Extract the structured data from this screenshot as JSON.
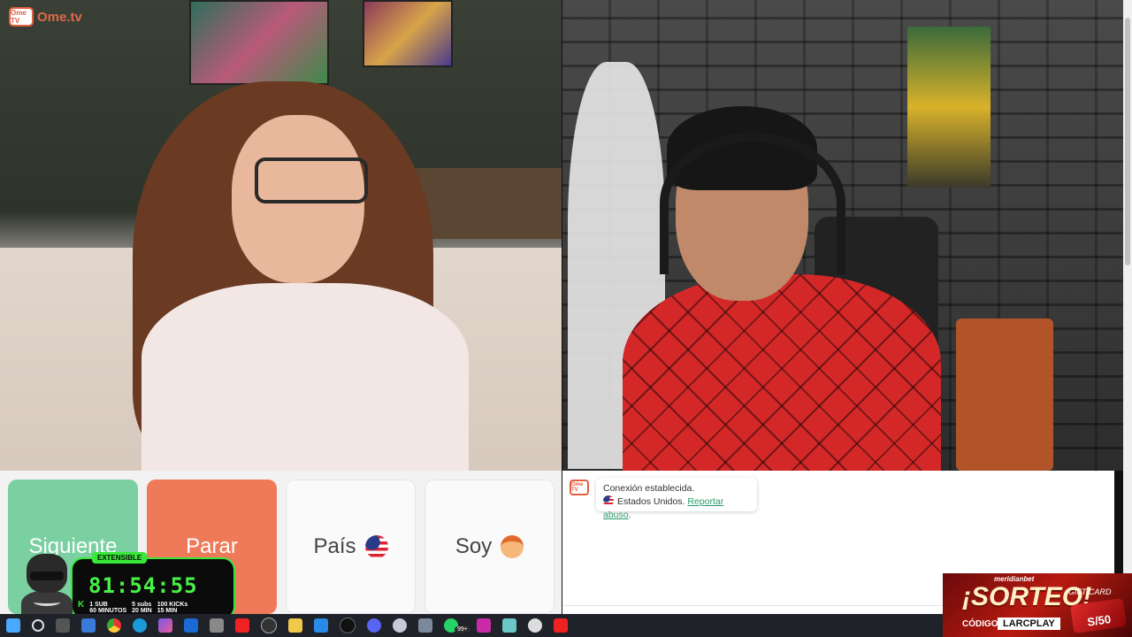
{
  "app": {
    "logo_text": "Ome.tv",
    "logo_tv": "Ome TV"
  },
  "controls": {
    "next_label": "Siguiente",
    "stop_label": "Parar",
    "country_label": "País",
    "gender_label": "Soy",
    "country_flag_icon": "us-flag-icon",
    "gender_icon": "boy-face-icon"
  },
  "chat": {
    "status_text": "Conexión establecida.",
    "country_text": "Estados Unidos.",
    "report_link": "Reportar abuso",
    "trailing_period": "."
  },
  "timer": {
    "badge": "EXTENSIBLE",
    "time": "81:54:55",
    "rules": [
      {
        "top": "1 SUB",
        "bottom": "60 MINUTOS"
      },
      {
        "top": "5 subs",
        "bottom": "20 MIN"
      },
      {
        "top": "100 KICKs",
        "bottom": "15 MIN"
      }
    ],
    "accent_color": "#38e838"
  },
  "ad": {
    "brand": "meridianbet",
    "title": "¡SORTEO!",
    "code_label": "CÓDIGO:",
    "code": "LARCPLAY",
    "gift_label": "GIFT CARD",
    "gift_value": "S/50"
  },
  "taskbar": {
    "badge_count": "99+",
    "icons": [
      "windows-start-icon",
      "search-icon",
      "task-view-icon",
      "widgets-icon",
      "chrome-icon",
      "edge-icon",
      "copilot-icon",
      "outlook-icon",
      "glasses-icon",
      "youtube-icon",
      "obs-icon",
      "folder-icon",
      "mail-icon",
      "tiktok-icon",
      "discord-icon",
      "app-icon",
      "calculator-icon",
      "whatsapp-icon",
      "kick-icon",
      "notes-icon",
      "mouse-icon",
      "youtube-studio-icon"
    ]
  },
  "colors": {
    "next": "#7ad0a0",
    "stop": "#ee7a5a",
    "link": "#2a9a6a",
    "brand": "#e06a4a"
  }
}
